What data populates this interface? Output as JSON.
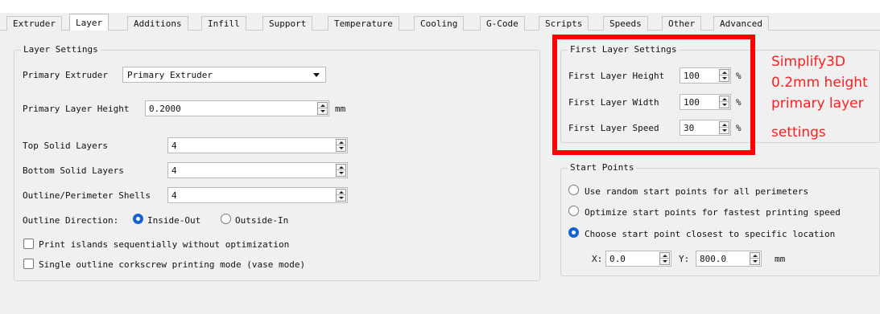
{
  "tabs": [
    {
      "label": "Extruder",
      "active": false
    },
    {
      "label": "Layer",
      "active": true
    },
    {
      "label": "Additions",
      "active": false
    },
    {
      "label": "Infill",
      "active": false
    },
    {
      "label": "Support",
      "active": false
    },
    {
      "label": "Temperature",
      "active": false
    },
    {
      "label": "Cooling",
      "active": false
    },
    {
      "label": "G-Code",
      "active": false
    },
    {
      "label": "Scripts",
      "active": false
    },
    {
      "label": "Speeds",
      "active": false
    },
    {
      "label": "Other",
      "active": false
    },
    {
      "label": "Advanced",
      "active": false
    }
  ],
  "layer_settings": {
    "title": "Layer Settings",
    "primary_extruder_label": "Primary Extruder",
    "primary_extruder_value": "Primary Extruder",
    "layer_height_label": "Primary Layer Height",
    "layer_height_value": "0.2000",
    "layer_height_unit": "mm",
    "top_solid_label": "Top Solid Layers",
    "top_solid_value": "4",
    "bottom_solid_label": "Bottom Solid Layers",
    "bottom_solid_value": "4",
    "shells_label": "Outline/Perimeter Shells",
    "shells_value": "4",
    "outline_direction_label": "Outline Direction:",
    "inside_out_label": "Inside-Out",
    "outside_in_label": "Outside-In",
    "islands_label": "Print islands sequentially without optimization",
    "vase_label": "Single outline corkscrew printing mode (vase mode)"
  },
  "first_layer": {
    "title": "First Layer Settings",
    "height_label": "First Layer Height",
    "height_value": "100",
    "width_label": "First Layer Width",
    "width_value": "100",
    "speed_label": "First Layer Speed",
    "speed_value": "30",
    "unit": "%"
  },
  "start_points": {
    "title": "Start Points",
    "random_label": "Use random start points for all perimeters",
    "optimize_label": "Optimize start points for fastest printing speed",
    "closest_label": "Choose start point closest to specific location",
    "x_label": "X:",
    "x_value": "0.0",
    "y_label": "Y:",
    "y_value": "800.0",
    "unit": "mm"
  },
  "annotation": {
    "line1": "Simplify3D",
    "line2": "0.2mm  height",
    "line3": "primary layer",
    "line4": "settings"
  },
  "colors": {
    "highlight": "#ff0000",
    "annotation_text": "#ff2020",
    "radio_checked": "#1463d1",
    "panel_bg": "#f0f0f0"
  }
}
